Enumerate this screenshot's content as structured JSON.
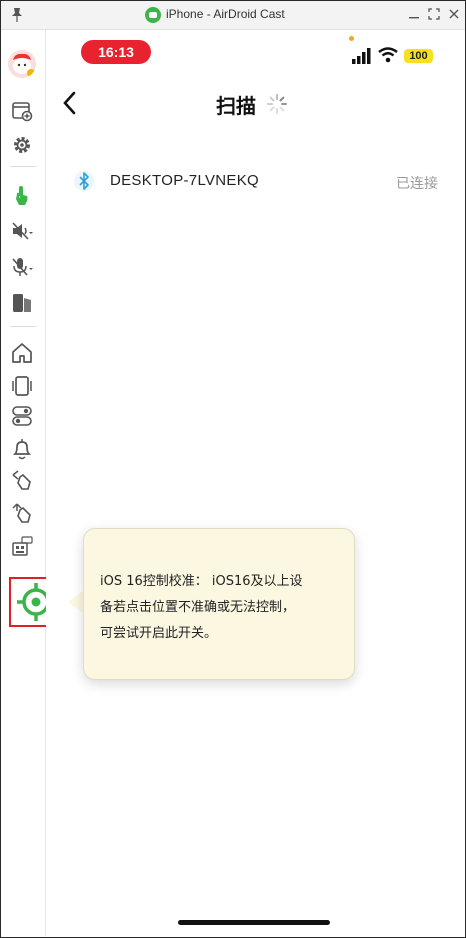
{
  "window": {
    "title": "iPhone - AirDroid Cast",
    "icons": [
      "pin-icon",
      "airdroid-logo-icon",
      "minimize-icon",
      "fullscreen-icon",
      "close-icon"
    ]
  },
  "sidebar": {
    "items": [
      {
        "name": "avatar"
      },
      {
        "name": "screen-add-icon"
      },
      {
        "name": "settings-icon"
      },
      {
        "name": "touch-control-icon",
        "color": "#3bb54a"
      },
      {
        "name": "volume-mute-icon"
      },
      {
        "name": "mic-mute-icon"
      },
      {
        "name": "screen-copy-icon"
      },
      {
        "name": "home-icon"
      },
      {
        "name": "rotate-icon"
      },
      {
        "name": "toggle-icon"
      },
      {
        "name": "bell-icon"
      },
      {
        "name": "back-gesture-icon"
      },
      {
        "name": "forward-gesture-icon"
      },
      {
        "name": "keyboard-icon"
      },
      {
        "name": "calibration-target-icon",
        "color": "#3bb54a"
      }
    ]
  },
  "phone": {
    "status": {
      "time": "16:13",
      "battery": "100"
    },
    "header": {
      "title": "扫描"
    },
    "device": {
      "name": "DESKTOP-7LVNEKQ",
      "status": "已连接"
    }
  },
  "tooltip": {
    "line1": "iOS 16控制校准： iOS16及以上设",
    "line2": "备若点击位置不准确或无法控制，",
    "line3": "可尝试开启此开关。"
  },
  "colors": {
    "accent_green": "#3bb54a",
    "time_pill": "#e8232f",
    "battery": "#f7e11d",
    "highlight_border": "#e02020",
    "tooltip_bg": "#fbf7e1"
  }
}
